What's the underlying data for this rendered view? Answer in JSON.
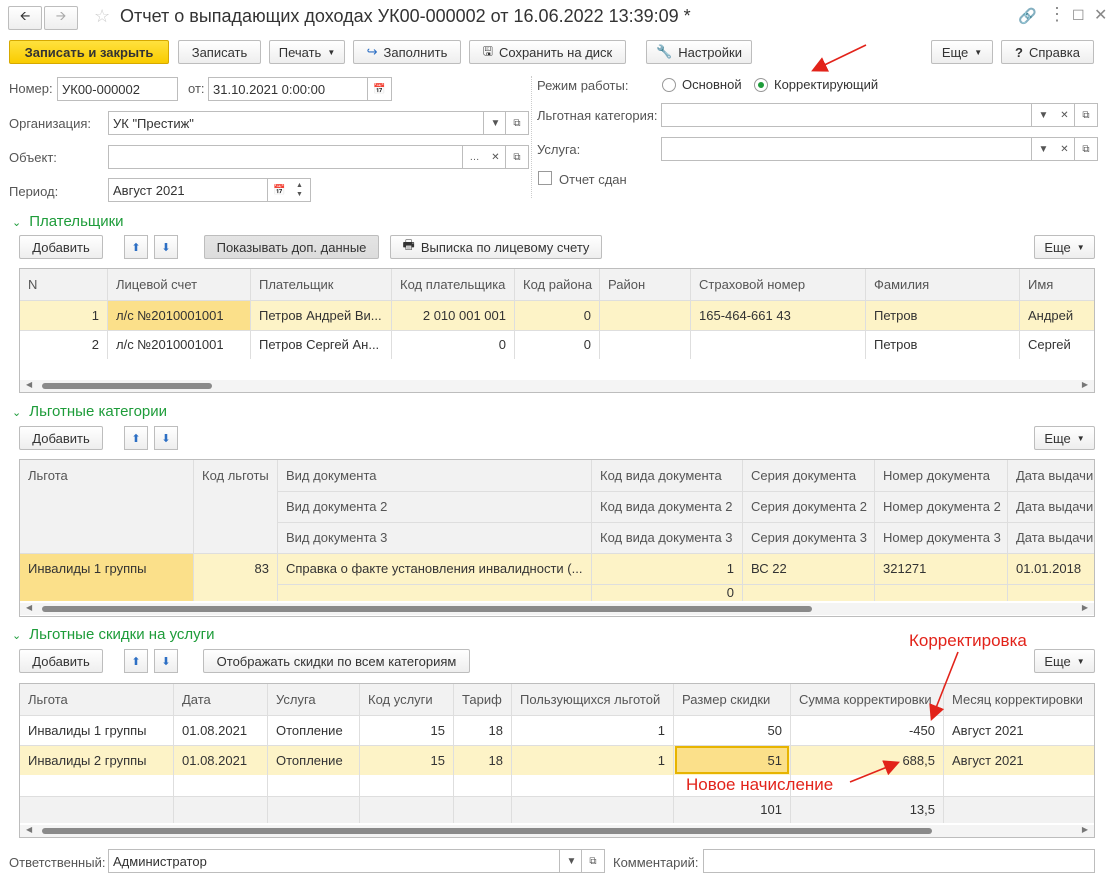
{
  "window": {
    "title": "Отчет о выпадающих доходах УК00-000002 от 16.06.2022 13:39:09 *"
  },
  "toolbar": {
    "save_close": "Записать и закрыть",
    "save": "Записать",
    "print": "Печать",
    "fill": "Заполнить",
    "save_disk": "Сохранить на диск",
    "settings": "Настройки",
    "more": "Еще",
    "help": "Справка"
  },
  "form": {
    "number_label": "Номер:",
    "number": "УК00-000002",
    "from_label": "от:",
    "date": "31.10.2021  0:00:00",
    "org_label": "Организация:",
    "org": "УК \"Престиж\"",
    "object_label": "Объект:",
    "object": "",
    "period_label": "Период:",
    "period": "Август 2021",
    "mode_label": "Режим работы:",
    "mode_basic": "Основной",
    "mode_correcting": "Корректирующий",
    "category_label": "Льготная категория:",
    "category": "",
    "service_label": "Услуга:",
    "service": "",
    "submitted_label": "Отчет сдан"
  },
  "payers": {
    "title": "Плательщики",
    "add": "Добавить",
    "show_extra": "Показывать доп. данные",
    "statement": "Выписка по лицевому счету",
    "more": "Еще",
    "columns": [
      "N",
      "Лицевой счет",
      "Плательщик",
      "Код плательщика",
      "Код района",
      "Район",
      "Страховой номер",
      "Фамилия",
      "Имя"
    ],
    "rows": [
      [
        "1",
        "л/с №2010001001",
        "Петров Андрей Ви...",
        "2 010 001 001",
        "0",
        "",
        "165-464-661 43",
        "Петров",
        "Андрей"
      ],
      [
        "2",
        "л/с №2010001001",
        "Петров Сергей Ан...",
        "0",
        "0",
        "",
        "",
        "Петров",
        "Сергей"
      ]
    ]
  },
  "categories": {
    "title": "Льготные категории",
    "add": "Добавить",
    "more": "Еще",
    "h_benefit": "Льгота",
    "h_code": "Код льготы",
    "h_doc": "Вид документа",
    "h_doc2": "Вид документа 2",
    "h_doc3": "Вид документа 3",
    "h_doccode": "Код вида документа",
    "h_doccode2": "Код вида документа 2",
    "h_doccode3": "Код вида документа 3",
    "h_series": "Серия документа",
    "h_series2": "Серия документа 2",
    "h_series3": "Серия документа 3",
    "h_num": "Номер документа",
    "h_num2": "Номер документа 2",
    "h_num3": "Номер документа 3",
    "h_date": "Дата выдачи",
    "row": {
      "benefit": "Инвалиды 1 группы",
      "code": "83",
      "doc": "Справка о факте установления инвалидности (...",
      "doccode": "1",
      "doccode_b": "0",
      "series": "ВС 22",
      "num": "321271",
      "date": "01.01.2018"
    }
  },
  "discounts": {
    "title": "Льготные скидки на услуги",
    "add": "Добавить",
    "show_all": "Отображать скидки по всем категориям",
    "more": "Еще",
    "columns": [
      "Льгота",
      "Дата",
      "Услуга",
      "Код услуги",
      "Тариф",
      "Пользующихся льготой",
      "Размер скидки",
      "Сумма корректировки",
      "Месяц корректировки"
    ],
    "rows": [
      [
        "Инвалиды 1 группы",
        "01.08.2021",
        "Отопление",
        "15",
        "18",
        "1",
        "50",
        "-450",
        "Август 2021"
      ],
      [
        "Инвалиды 2 группы",
        "01.08.2021",
        "Отопление",
        "15",
        "18",
        "1",
        "51",
        "688,5",
        "Август 2021"
      ]
    ],
    "totals": {
      "discount": "101",
      "correction": "13,5"
    }
  },
  "annotations": {
    "correction": "Корректировка",
    "new_charge": "Новое начисление"
  },
  "footer": {
    "responsible_label": "Ответственный:",
    "responsible": "Администратор",
    "comment_label": "Комментарий:",
    "comment": ""
  },
  "colors": {
    "accent_green": "#1e9c3a",
    "highlight_row": "#fdf3c7",
    "highlight_cell": "#fbe08a",
    "annotation_red": "#e2231a",
    "primary_button": "#f9cc00"
  }
}
